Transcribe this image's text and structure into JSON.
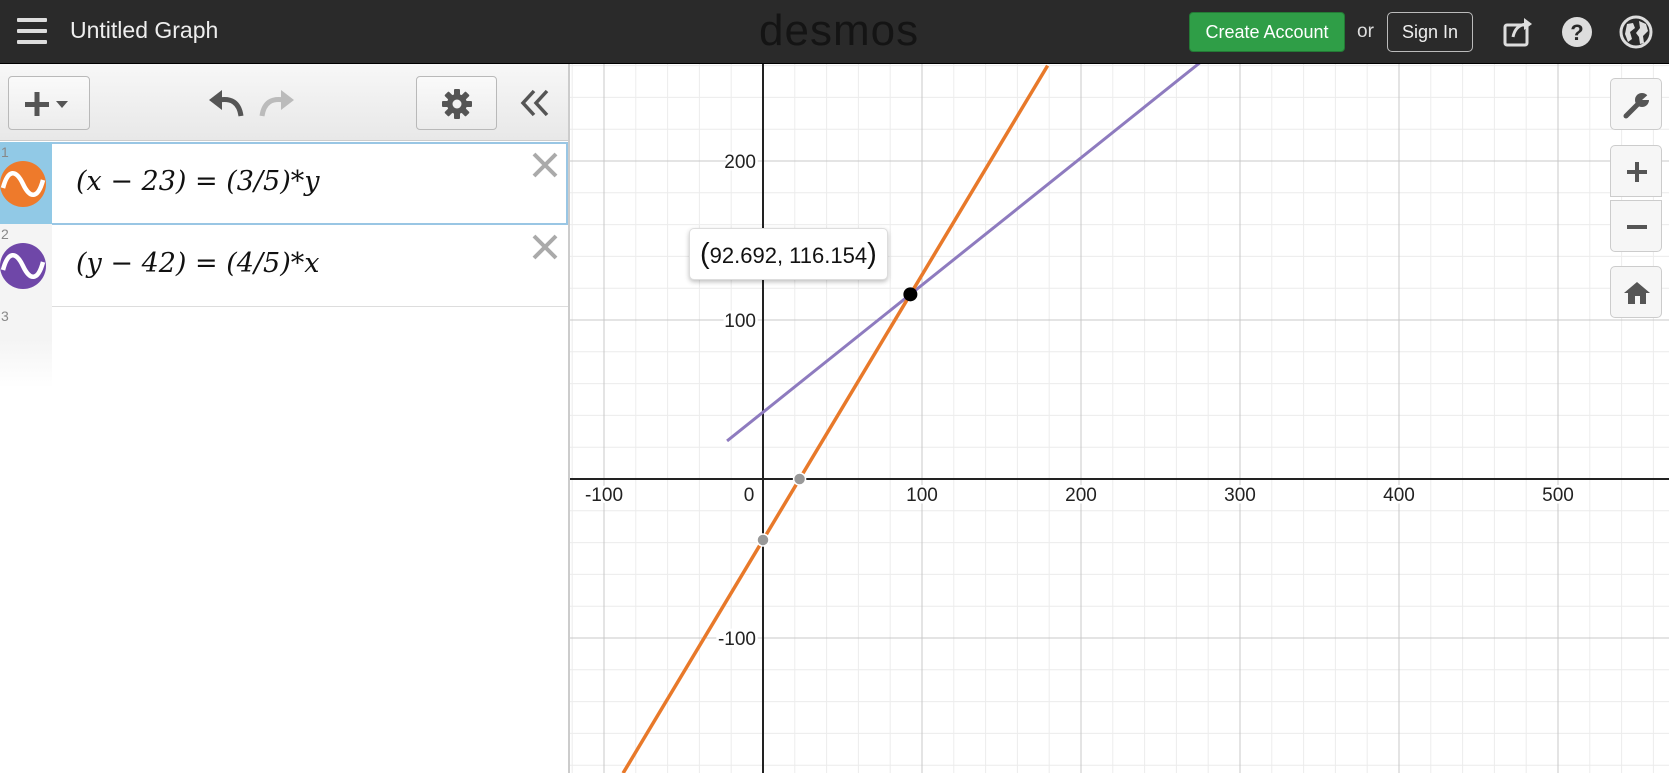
{
  "header": {
    "title": "Untitled Graph",
    "brand": "desmos",
    "create_account": "Create Account",
    "or": "or",
    "sign_in": "Sign In"
  },
  "expressions": [
    {
      "index": "1",
      "latex": "(x − 23) = (3/5)*y",
      "color": "#ee7a2b"
    },
    {
      "index": "2",
      "latex": "(y − 42) = (4/5)*x",
      "color": "#6f47a8"
    },
    {
      "index": "3",
      "latex": ""
    }
  ],
  "graph": {
    "x_ticks": [
      "-100",
      "0",
      "100",
      "200",
      "300",
      "400",
      "500"
    ],
    "y_ticks": [
      "200",
      "100",
      "-100"
    ],
    "tooltip": {
      "open": "(",
      "value": "92.692, 116.154",
      "close": ")"
    },
    "colors": {
      "orange": "#e8792a",
      "purple": "#8e7bbf"
    }
  },
  "icons": [
    "menu-icon",
    "share-icon",
    "help-icon",
    "globe-icon",
    "add-icon",
    "undo-icon",
    "redo-icon",
    "gear-icon",
    "collapse-icon",
    "wrench-icon",
    "zoom-in-icon",
    "zoom-out-icon",
    "home-icon",
    "close-icon"
  ]
}
